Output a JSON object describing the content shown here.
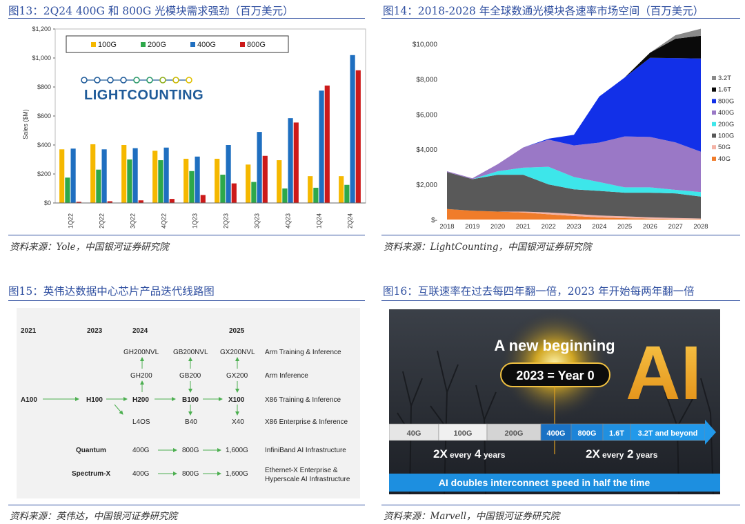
{
  "fig13": {
    "title": "图13：2Q24 400G 和 800G 光模块需求强劲（百万美元）",
    "source": "资料来源：Yole，中国银河证券研究院",
    "logo_text": "LIGHTCOUNTING",
    "chart_data": {
      "type": "bar",
      "ylabel": "Sales ($M)",
      "ylim": [
        0,
        1200
      ],
      "yticks": [
        "$0",
        "$200",
        "$400",
        "$600",
        "$800",
        "$1,000",
        "$1,200"
      ],
      "categories": [
        "1Q22",
        "2Q22",
        "3Q22",
        "4Q22",
        "1Q23",
        "2Q23",
        "3Q23",
        "4Q23",
        "1Q24",
        "2Q24"
      ],
      "legend_position": "top",
      "series": [
        {
          "name": "100G",
          "color": "#f5b800",
          "values": [
            370,
            405,
            400,
            360,
            305,
            305,
            265,
            295,
            185,
            185
          ]
        },
        {
          "name": "200G",
          "color": "#2ea84a",
          "values": [
            175,
            230,
            300,
            295,
            220,
            195,
            145,
            100,
            105,
            125
          ]
        },
        {
          "name": "400G",
          "color": "#1f6fc0",
          "values": [
            375,
            370,
            378,
            382,
            320,
            400,
            490,
            585,
            775,
            1020
          ]
        },
        {
          "name": "800G",
          "color": "#cc1a1a",
          "values": [
            8,
            12,
            18,
            28,
            55,
            135,
            325,
            555,
            810,
            915
          ]
        }
      ]
    }
  },
  "fig14": {
    "title": "图14：2018-2028 年全球数通光模块各速率市场空间（百万美元）",
    "source": "资料来源：LightCounting，中国银河证券研究院",
    "chart_data": {
      "type": "area",
      "stacked": true,
      "ylim": [
        0,
        11000
      ],
      "yticks": [
        "$-",
        "$2,000",
        "$4,000",
        "$6,000",
        "$8,000",
        "$10,000"
      ],
      "ytick_values": [
        0,
        2000,
        4000,
        6000,
        8000,
        10000
      ],
      "x": [
        "2018",
        "2019",
        "2020",
        "2021",
        "2022",
        "2023",
        "2024",
        "2025",
        "2026",
        "2027",
        "2028"
      ],
      "legend_position": "right",
      "series": [
        {
          "name": "40G",
          "color": "#f07c2a",
          "values": [
            600,
            500,
            450,
            400,
            300,
            200,
            120,
            80,
            50,
            30,
            20
          ]
        },
        {
          "name": "50G",
          "color": "#f4b3a6",
          "values": [
            0,
            0,
            0,
            50,
            100,
            120,
            110,
            100,
            80,
            60,
            40
          ]
        },
        {
          "name": "100G",
          "color": "#595959",
          "values": [
            2100,
            1800,
            2100,
            2100,
            1600,
            1400,
            1400,
            1350,
            1400,
            1400,
            1250
          ]
        },
        {
          "name": "200G",
          "color": "#3de6ea",
          "values": [
            0,
            0,
            200,
            400,
            1000,
            700,
            500,
            300,
            300,
            200,
            250
          ]
        },
        {
          "name": "400G",
          "color": "#9a78c6",
          "values": [
            50,
            50,
            400,
            1150,
            1550,
            1800,
            2250,
            2900,
            2870,
            2700,
            2300
          ]
        },
        {
          "name": "800G",
          "color": "#1230e8",
          "values": [
            0,
            0,
            0,
            0,
            50,
            600,
            2620,
            3350,
            4500,
            4800,
            5300
          ]
        },
        {
          "name": "1.6T",
          "color": "#0a0a0a",
          "values": [
            0,
            0,
            0,
            0,
            0,
            0,
            0,
            0,
            300,
            1100,
            1300
          ]
        },
        {
          "name": "3.2T",
          "color": "#8a8a8a",
          "values": [
            0,
            0,
            0,
            0,
            0,
            0,
            0,
            0,
            0,
            200,
            400
          ]
        }
      ]
    }
  },
  "fig15": {
    "title": "图15：英伟达数据中心芯片产品迭代线路图",
    "source": "资料来源：英伟达，中国银河证券研究院",
    "years": [
      "2021",
      "2023",
      "2024",
      "2025"
    ],
    "rows": {
      "arm_training": [
        "GH200NVL",
        "GB200NVL",
        "GX200NVL",
        "Arm Training & Inference"
      ],
      "arm_inference": [
        "GH200",
        "GB200",
        "GX200",
        "Arm Inference"
      ],
      "x86_training": [
        "A100",
        "H100",
        "H200",
        "B100",
        "X100",
        "X86 Training & Inference"
      ],
      "x86_enterprise": [
        "L4OS",
        "B40",
        "X40",
        "X86 Enterprise & Inference"
      ],
      "quantum": [
        "Quantum",
        "400G",
        "800G",
        "1,600G",
        "InfiniBand AI Infrastructure"
      ],
      "spectrum": [
        "Spectrum-X",
        "400G",
        "800G",
        "1,600G",
        "Ethernet-X Enterprise &",
        "Hyperscale AI Infrastructure"
      ]
    }
  },
  "fig16": {
    "title": "图16：互联速率在过去每四年翻一倍，2023 年开始每两年翻一倍",
    "source": "资料来源：Marvell，中国银河证券研究院",
    "headline": "A new beginning",
    "year_badge": "2023 = Year 0",
    "ai_text": "AI",
    "speeds": [
      "40G",
      "100G",
      "200G",
      "400G",
      "800G",
      "1.6T",
      "3.2T and beyond"
    ],
    "rate_left_prefix": "2X",
    "rate_left_suffix": "every",
    "rate_left_num": "4",
    "rate_left_unit": "years",
    "rate_right_prefix": "2X",
    "rate_right_suffix": "every",
    "rate_right_num": "2",
    "rate_right_unit": "years",
    "banner": "AI doubles interconnect speed in half the time"
  }
}
